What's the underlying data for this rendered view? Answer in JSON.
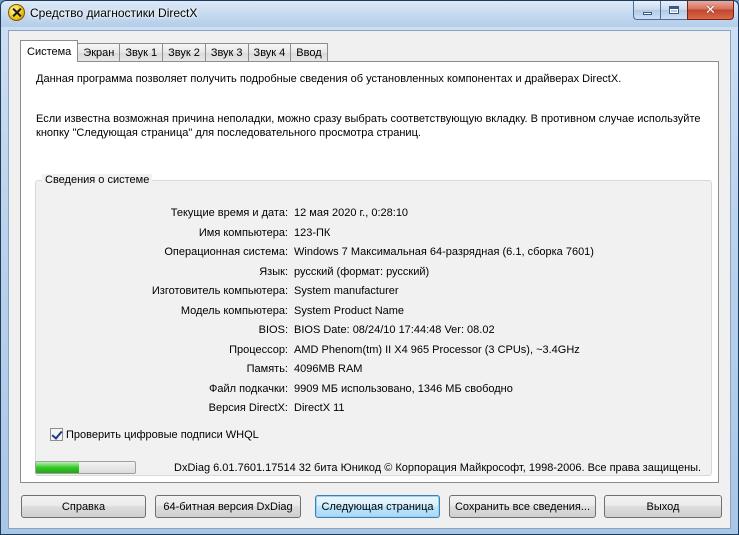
{
  "window": {
    "title": "Средство диагностики DirectX"
  },
  "tabs": [
    {
      "label": "Система",
      "active": true
    },
    {
      "label": "Экран",
      "active": false
    },
    {
      "label": "Звук 1",
      "active": false
    },
    {
      "label": "Звук 2",
      "active": false
    },
    {
      "label": "Звук 3",
      "active": false
    },
    {
      "label": "Звук 4",
      "active": false
    },
    {
      "label": "Ввод",
      "active": false
    }
  ],
  "intro": {
    "line1": "Данная программа позволяет получить подробные сведения об установленных компонентах и драйверах DirectX.",
    "line2": "Если известна возможная причина неполадки, можно сразу выбрать соответствующую вкладку. В противном случае используйте кнопку \"Следующая страница\" для последовательного просмотра страниц."
  },
  "system_info": {
    "group_title": "Сведения о системе",
    "rows": [
      {
        "label": "Текущие время и дата:",
        "value": "12 мая 2020 г., 0:28:10"
      },
      {
        "label": "Имя компьютера:",
        "value": "123-ПК"
      },
      {
        "label": "Операционная система:",
        "value": "Windows 7 Максимальная 64-разрядная (6.1, сборка 7601)"
      },
      {
        "label": "Язык:",
        "value": "русский (формат: русский)"
      },
      {
        "label": "Изготовитель компьютера:",
        "value": "System manufacturer"
      },
      {
        "label": "Модель компьютера:",
        "value": "System Product Name"
      },
      {
        "label": "BIOS:",
        "value": "BIOS Date: 08/24/10 17:44:48 Ver: 08.02"
      },
      {
        "label": "Процессор:",
        "value": "AMD Phenom(tm) II X4 965 Processor (3 CPUs), ~3.4GHz"
      },
      {
        "label": "Память:",
        "value": "4096MB RAM"
      },
      {
        "label": "Файл подкачки:",
        "value": "9909 МБ использовано, 1346 МБ свободно"
      },
      {
        "label": "Версия DirectX:",
        "value": "DirectX 11"
      }
    ],
    "whql_label": "Проверить цифровые подписи WHQL",
    "whql_checked": true
  },
  "footer": {
    "progress_fraction": 0.43,
    "version_text": "DxDiag 6.01.7601.17514 32 бита Юникод  © Корпорация Майкрософт, 1998-2006.  Все права защищены."
  },
  "buttons": {
    "help": "Справка",
    "x64": "64-битная версия DxDiag",
    "next": "Следующая страница",
    "save": "Сохранить все сведения...",
    "exit": "Выход"
  },
  "colors": {
    "title_bar": "#c6daf0",
    "close_button": "#c2452c",
    "progress_fill": "#38c72a"
  }
}
